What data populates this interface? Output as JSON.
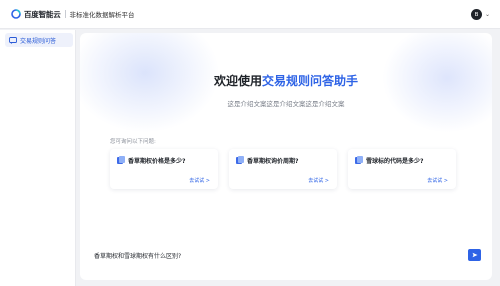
{
  "header": {
    "brand": "百度智能云",
    "platform": "非标准化数据解析平台",
    "avatar_initial": "B"
  },
  "sidebar": {
    "items": [
      {
        "label": "交易规则问答"
      }
    ]
  },
  "main": {
    "headline_prefix": "欢迎使用",
    "headline_highlight": "交易规则问答助手",
    "subline": "这是介绍文案这是介绍文案这是介绍文案",
    "prompt_hint": "您可询问以下问题:",
    "cards": [
      {
        "question": "香草期权价格是多少?",
        "try_label": "去试试 >"
      },
      {
        "question": "香草期权询价周期?",
        "try_label": "去试试 >"
      },
      {
        "question": "雪球标的代码是多少?",
        "try_label": "去试试 >"
      }
    ],
    "input_value": "香草期权和雪球期权有什么区别?"
  },
  "colors": {
    "accent": "#2e63e6",
    "sidebar_active_bg": "#eef1fb",
    "page_bg": "#f1f2f5"
  },
  "icons": {
    "logo": "baidu-cloud-logo",
    "sidebar_item": "chat-icon",
    "card": "book-icon",
    "send": "send-icon",
    "user_menu": "chevron-down-icon"
  }
}
